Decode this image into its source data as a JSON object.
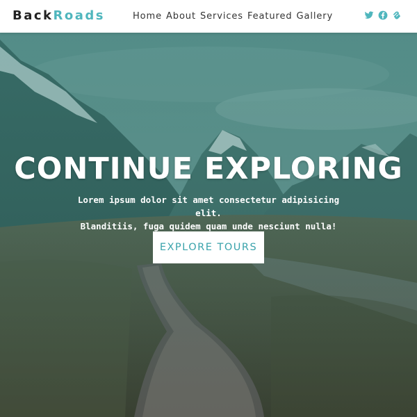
{
  "brand": {
    "part1": "Back",
    "part2": "Roads"
  },
  "nav": {
    "links": [
      "Home",
      "About",
      "Services",
      "Featured",
      "Gallery"
    ],
    "icons": [
      "twitter-icon",
      "facebook-icon",
      "squarespace-icon"
    ]
  },
  "hero": {
    "title": "CONTINUE EXPLORING",
    "line1": "Lorem ipsum dolor sit amet consectetur adipisicing elit.",
    "line2": "Blanditiis, fuga quidem quam unde nesciunt nulla!",
    "button": "EXPLORE TOURS"
  },
  "colors": {
    "accent": "#4fb6bd",
    "button_text": "#3aa3ab",
    "nav_bg": "#ffffff"
  }
}
